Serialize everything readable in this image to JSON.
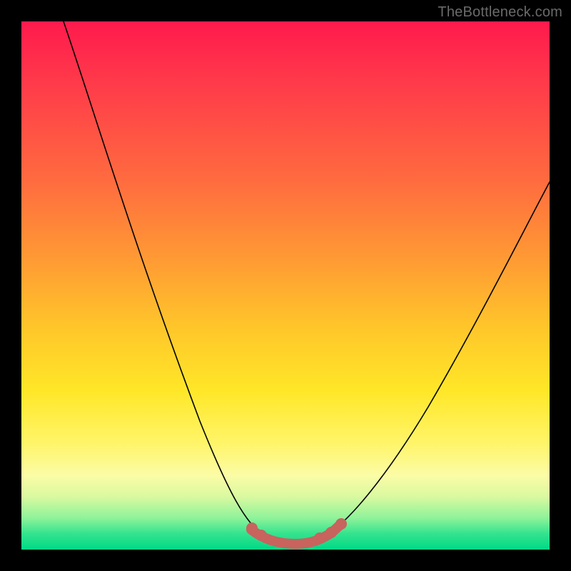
{
  "watermark": "TheBottleneck.com",
  "colors": {
    "background_black": "#000000",
    "gradient_top": "#ff1a4d",
    "gradient_bottom": "#00d986",
    "curve_stroke": "#000000",
    "highlight_stroke": "#c8635e",
    "watermark_text": "#6a6a6a"
  },
  "chart_data": {
    "type": "line",
    "title": "",
    "xlabel": "",
    "ylabel": "",
    "xlim": [
      0,
      100
    ],
    "ylim": [
      0,
      100
    ],
    "grid": false,
    "legend": false,
    "series": [
      {
        "name": "bottleneck-curve",
        "x": [
          8,
          12,
          16,
          20,
          24,
          28,
          32,
          36,
          40,
          43,
          46,
          49,
          52,
          55,
          58,
          62,
          66,
          70,
          74,
          78,
          82,
          86,
          90,
          94,
          98
        ],
        "y": [
          100,
          90,
          79,
          68,
          57,
          46,
          36,
          26,
          17,
          10,
          5,
          2,
          0,
          0,
          2,
          6,
          12,
          19,
          26,
          33,
          40,
          47,
          54,
          60,
          66
        ]
      }
    ],
    "highlight_range_x": [
      44,
      60
    ],
    "highlight_dots_x": [
      45,
      47,
      56,
      58,
      60
    ]
  }
}
